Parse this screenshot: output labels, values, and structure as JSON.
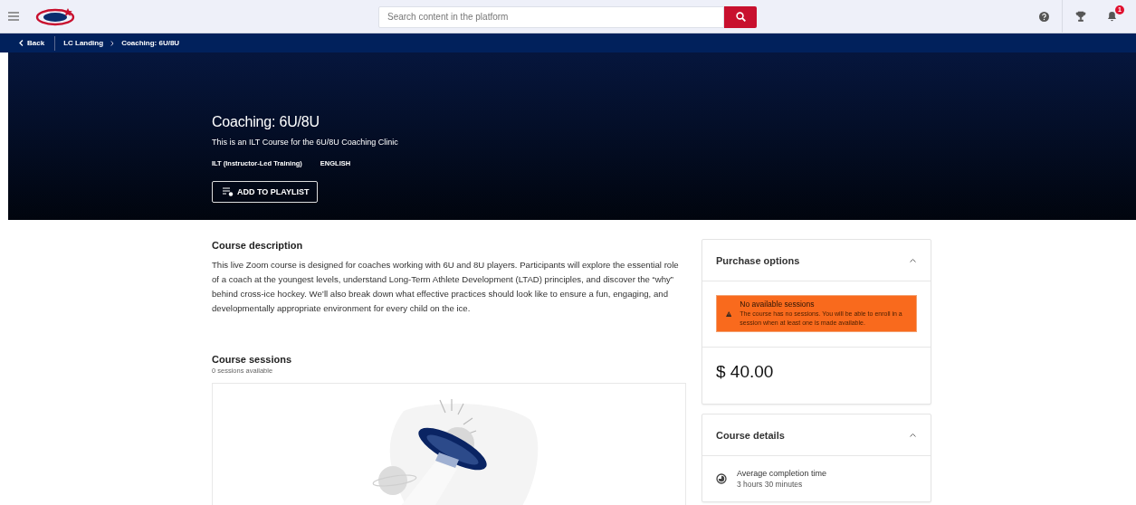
{
  "header": {
    "search": {
      "placeholder": "Search content in the platform"
    },
    "notification_count": "1"
  },
  "breadcrumb": {
    "back": "Back",
    "items": [
      "LC Landing",
      "Coaching: 6U/8U"
    ]
  },
  "hero": {
    "title": "Coaching: 6U/8U",
    "subtitle": "This is an ILT Course for the 6U/8U Coaching Clinic",
    "tags": [
      "ILT (Instructor-Led Training)",
      "ENGLISH"
    ],
    "button": "ADD TO PLAYLIST"
  },
  "description": {
    "heading": "Course description",
    "text": "This live Zoom course is designed for coaches working with 6U and 8U players. Participants will explore the essential role of a coach at the youngest levels, understand Long-Term Athlete Development (LTAD) principles, and discover the “why” behind cross-ice hockey. We’ll also break down what effective practices should look like to ensure a fun, engaging, and developmentally appropriate environment for every child on the ice."
  },
  "sessions": {
    "heading": "Course sessions",
    "count": "0 sessions available"
  },
  "purchase": {
    "heading": "Purchase options",
    "expanded": true,
    "alert": {
      "title": "No available sessions",
      "text": "The course has no sessions. You will be able to enroll in a session when at least one is made available."
    },
    "price": "$ 40.00"
  },
  "details": {
    "heading": "Course details",
    "expanded": true,
    "items": [
      {
        "label": "Average completion time",
        "value": "3 hours 30 minutes"
      }
    ]
  }
}
